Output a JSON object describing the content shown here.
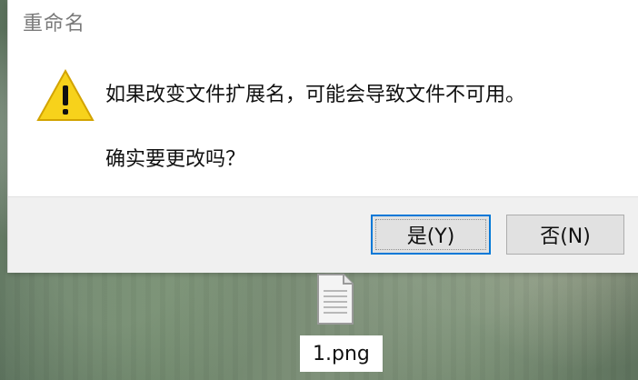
{
  "dialog": {
    "title": "重命名",
    "message": "如果改变文件扩展名，可能会导致文件不可用。",
    "confirm": "确实要更改吗？",
    "buttons": {
      "yes": "是(Y)",
      "no": "否(N)"
    },
    "icons": {
      "warning": "warning-icon"
    },
    "colors": {
      "accent": "#0078d7",
      "warning_yellow": "#f7d21b"
    }
  },
  "desktop": {
    "file_label": "1.png",
    "icons": {
      "file": "file-icon"
    }
  }
}
